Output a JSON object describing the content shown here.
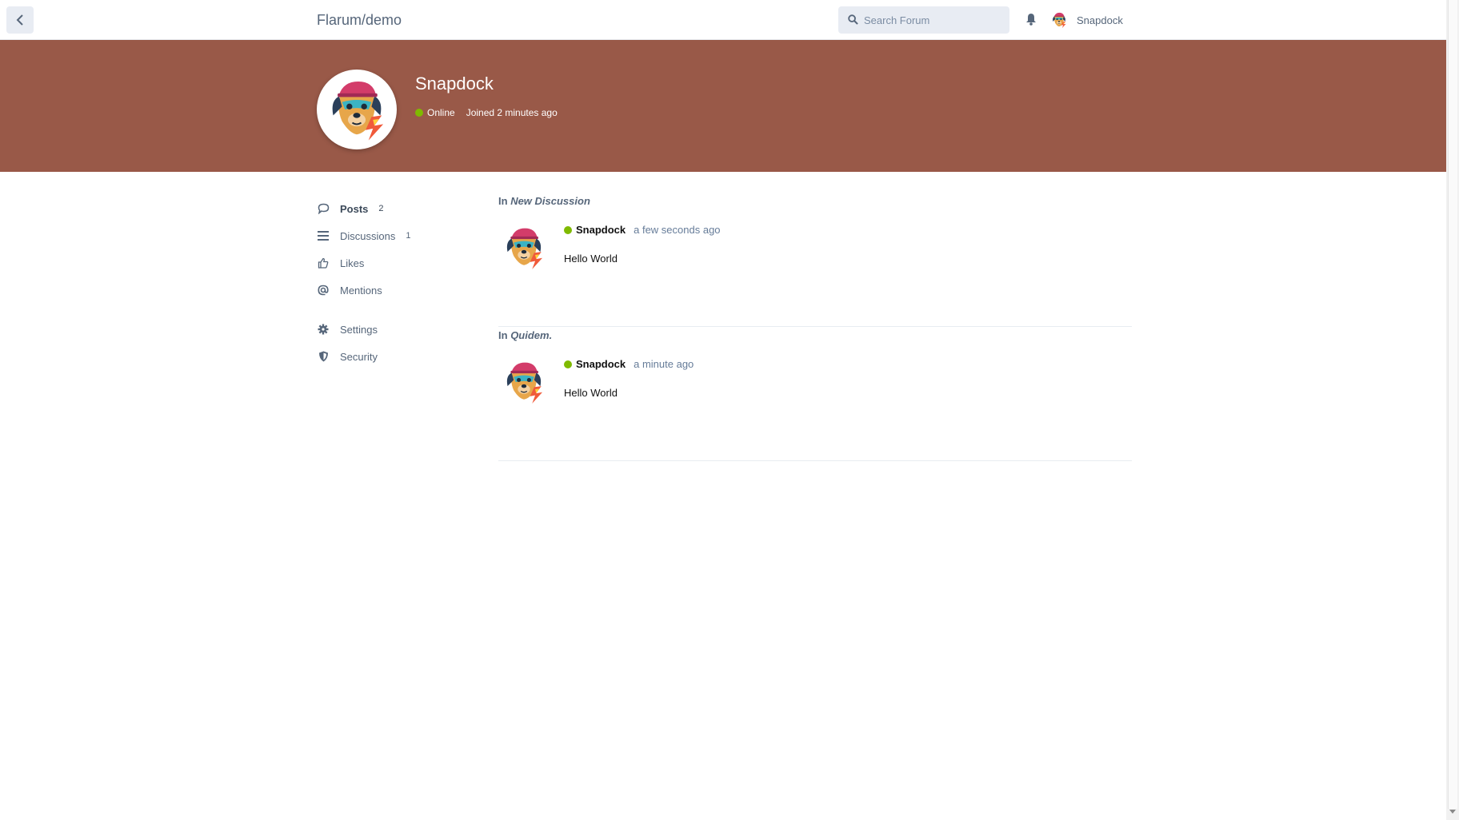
{
  "header": {
    "brand": "Flarum/demo",
    "search_placeholder": "Search Forum",
    "username": "Snapdock"
  },
  "hero": {
    "name": "Snapdock",
    "status": "Online",
    "joined": "Joined 2 minutes ago",
    "color": "#995948"
  },
  "nav": {
    "items": [
      {
        "label": "Posts",
        "count": "2",
        "icon": "comment-icon"
      },
      {
        "label": "Discussions",
        "count": "1",
        "icon": "list-icon"
      },
      {
        "label": "Likes",
        "icon": "thumbs-up-icon"
      },
      {
        "label": "Mentions",
        "icon": "at-icon"
      }
    ],
    "settings": [
      {
        "label": "Settings",
        "icon": "gear-icon"
      },
      {
        "label": "Security",
        "icon": "shield-icon"
      }
    ]
  },
  "posts": [
    {
      "prefix": "In",
      "discussion": "New Discussion",
      "author": "Snapdock",
      "time": "a few seconds ago",
      "body": "Hello World"
    },
    {
      "prefix": "In",
      "discussion": "Quidem.",
      "author": "Snapdock",
      "time": "a minute ago",
      "body": "Hello World"
    }
  ],
  "colors": {
    "online": "#7fba00",
    "text_muted": "#667c99"
  }
}
